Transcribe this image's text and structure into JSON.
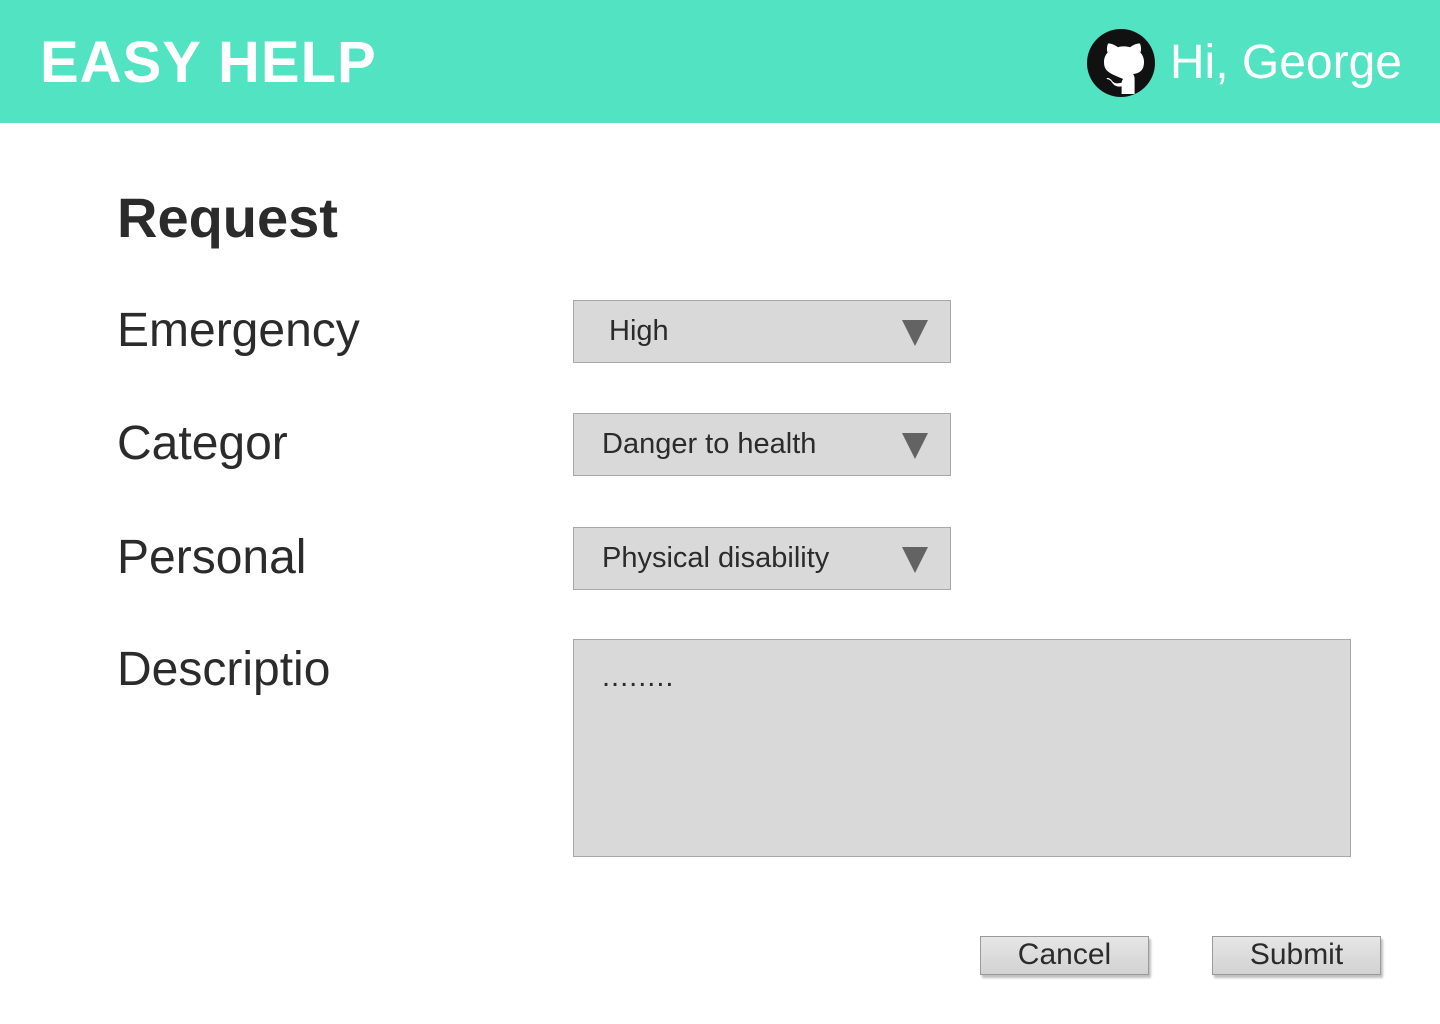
{
  "header": {
    "brand": "EASY HELP",
    "greeting": "Hi, George",
    "avatar_icon": "github-icon",
    "background_color": "#52e3c2"
  },
  "form": {
    "title": "Request",
    "fields": [
      {
        "label": "Emergency",
        "value": "High",
        "control": "select"
      },
      {
        "label": "Categor",
        "value": "Danger to health",
        "control": "select"
      },
      {
        "label": "Personal",
        "value": "Physical disability",
        "control": "select"
      },
      {
        "label": "Descriptio",
        "value": "........",
        "control": "textarea"
      }
    ]
  },
  "actions": {
    "cancel_label": "Cancel",
    "submit_label": "Submit"
  }
}
